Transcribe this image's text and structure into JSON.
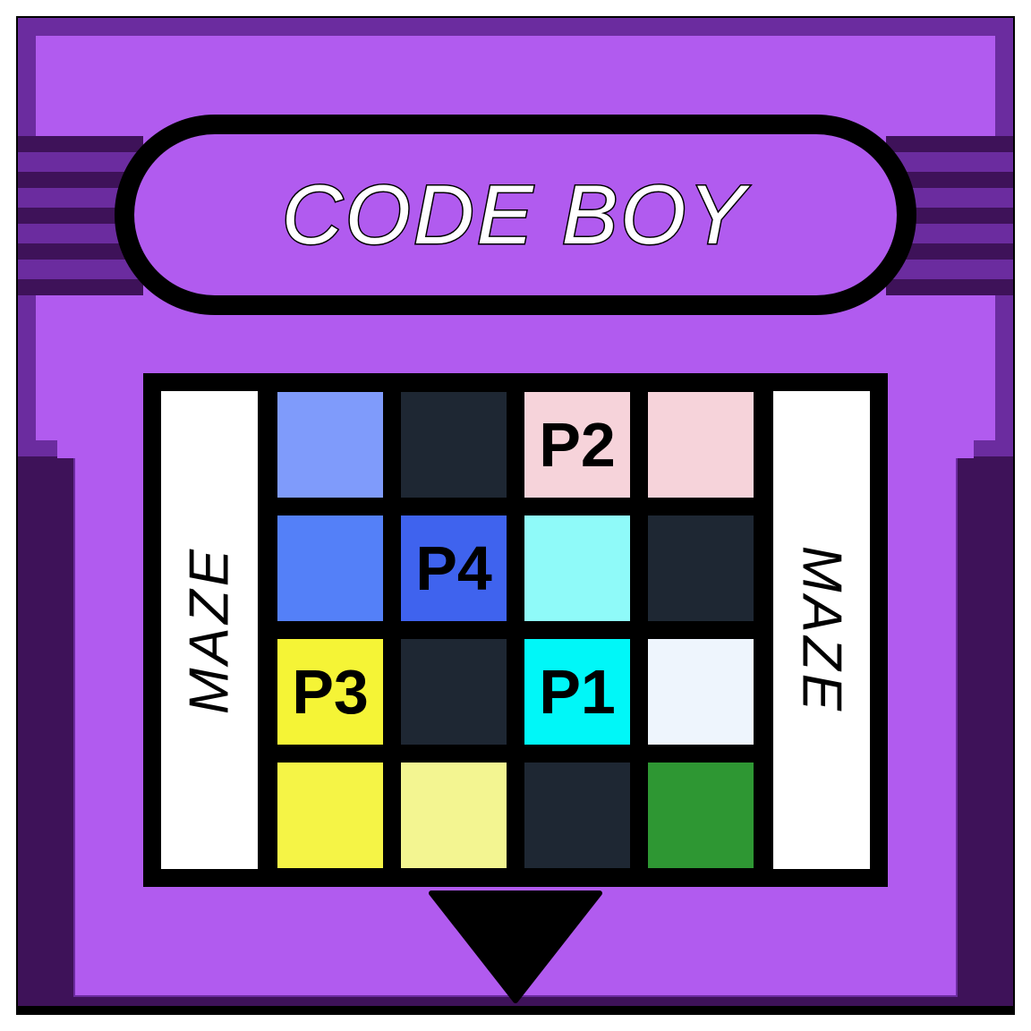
{
  "cartridge": {
    "title": "CODE BOY",
    "side_label_left": "MAZE",
    "side_label_right": "MAZE",
    "colors": {
      "shell": "#b15bef",
      "shell_shadow": "#6b2c9f",
      "shell_dark": "#3e1259",
      "outline": "#000000",
      "title_text": "#ffffff"
    }
  },
  "maze": {
    "rows": [
      [
        {
          "color": "#7f9bfb",
          "label": ""
        },
        {
          "color": "#1e2733",
          "label": ""
        },
        {
          "color": "#f6d3da",
          "label": "P2"
        },
        {
          "color": "#f6d3da",
          "label": ""
        }
      ],
      [
        {
          "color": "#5480f8",
          "label": ""
        },
        {
          "color": "#3f63ee",
          "label": "P4"
        },
        {
          "color": "#8ffaf9",
          "label": ""
        },
        {
          "color": "#1e2733",
          "label": ""
        }
      ],
      [
        {
          "color": "#f5f436",
          "label": "P3"
        },
        {
          "color": "#1e2733",
          "label": ""
        },
        {
          "color": "#00f7f8",
          "label": "P1"
        },
        {
          "color": "#eef5fd",
          "label": ""
        }
      ],
      [
        {
          "color": "#f5f446",
          "label": ""
        },
        {
          "color": "#f3f591",
          "label": ""
        },
        {
          "color": "#1e2733",
          "label": ""
        },
        {
          "color": "#2e9733",
          "label": ""
        }
      ]
    ]
  },
  "insert_arrow_icon": "down-triangle"
}
